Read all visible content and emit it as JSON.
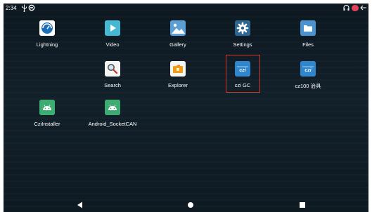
{
  "status_bar": {
    "time": "2:34",
    "icons": [
      "usb-icon",
      "sync-ring-icon",
      "headset-icon",
      "battery-icon",
      "back-arrow-icon"
    ],
    "battery_color": "#e2405d"
  },
  "apps": [
    {
      "label": "Lightning",
      "icon": "lightning-icon",
      "color": "#2a6ea3"
    },
    {
      "label": "Video",
      "icon": "play-icon",
      "color": "#3fb3cc"
    },
    {
      "label": "Gallery",
      "icon": "landscape-icon",
      "color": "#4a90c6"
    },
    {
      "label": "Settings",
      "icon": "gear-icon",
      "color": "#2c5f88"
    },
    {
      "label": "Files",
      "icon": "folder-icon",
      "color": "#3a85c4"
    },
    {
      "label": "Search",
      "icon": "search-icon",
      "color": "#f2f2f2"
    },
    {
      "label": "Explorer",
      "icon": "explorer-icon",
      "color": "#f4f4f4"
    },
    {
      "label": "czi GC",
      "icon": "czi-logo-icon",
      "color": "#2f7fc1",
      "logo_text": "czi"
    },
    {
      "label": "cz100 治具",
      "icon": "czi-logo-icon",
      "color": "#2f7fc1",
      "logo_text": "czi"
    },
    {
      "label": "CziInstaller",
      "icon": "android-icon",
      "color": "#3dac72"
    },
    {
      "label": "Android_SocketCAN",
      "icon": "android-icon",
      "color": "#3dac72"
    }
  ],
  "nav_bar": {
    "icons": [
      "back-triangle-icon",
      "home-circle-icon",
      "recents-square-icon"
    ]
  },
  "highlight_color": "#d3392b"
}
